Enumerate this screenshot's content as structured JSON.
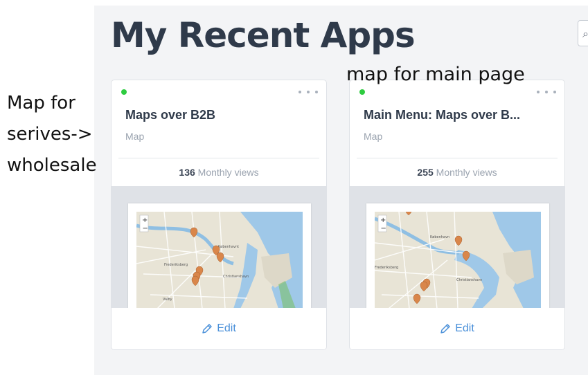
{
  "page": {
    "title": "My Recent Apps",
    "search_icon": "search-icon"
  },
  "notes": {
    "left_lines": [
      "Map for",
      "serives->",
      "wholesale"
    ],
    "right": "map for main page"
  },
  "cards": [
    {
      "title": "Maps over B2B",
      "type": "Map",
      "views_count": "136",
      "views_label": "Monthly views",
      "edit_label": "Edit",
      "status_color": "#2ecc40",
      "map_labels": [
        "Københavnt",
        "Frederiksberg",
        "Valby",
        "Christianshavn"
      ]
    },
    {
      "title": "Main Menu: Maps over B...",
      "type": "Map",
      "views_count": "255",
      "views_label": "Monthly views",
      "edit_label": "Edit",
      "status_color": "#2ecc40",
      "map_labels": [
        "København",
        "Frederiksberg",
        "Christianshavn"
      ]
    }
  ],
  "colors": {
    "accent": "#4a90d9",
    "title": "#2f3a4a",
    "muted": "#9aa3af",
    "status": "#2ecc40",
    "map_water": "#9fc8e8",
    "map_land": "#e8e4d6",
    "marker": "#d9864a"
  }
}
